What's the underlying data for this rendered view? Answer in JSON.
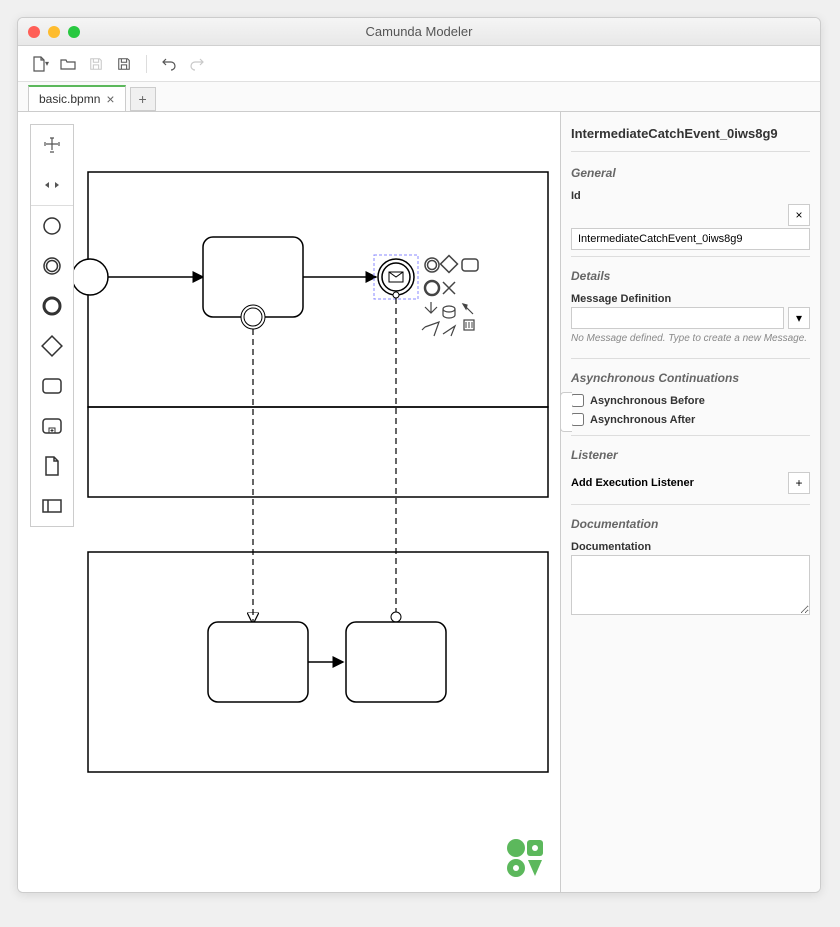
{
  "window": {
    "title": "Camunda Modeler"
  },
  "tabs": {
    "active": "basic.bpmn",
    "add_label": "+"
  },
  "properties": {
    "title": "IntermediateCatchEvent_0iws8g9",
    "general": {
      "heading": "General",
      "id_label": "Id",
      "id_value": "IntermediateCatchEvent_0iws8g9"
    },
    "details": {
      "heading": "Details",
      "msgdef_label": "Message Definition",
      "msgdef_value": "",
      "msgdef_hint": "No Message defined. Type to create a new Message."
    },
    "async": {
      "heading": "Asynchronous Continuations",
      "before_label": "Asynchronous Before",
      "after_label": "Asynchronous After"
    },
    "listener": {
      "heading": "Listener",
      "add_label": "Add Execution Listener"
    },
    "documentation": {
      "heading": "Documentation",
      "label": "Documentation",
      "value": ""
    }
  }
}
